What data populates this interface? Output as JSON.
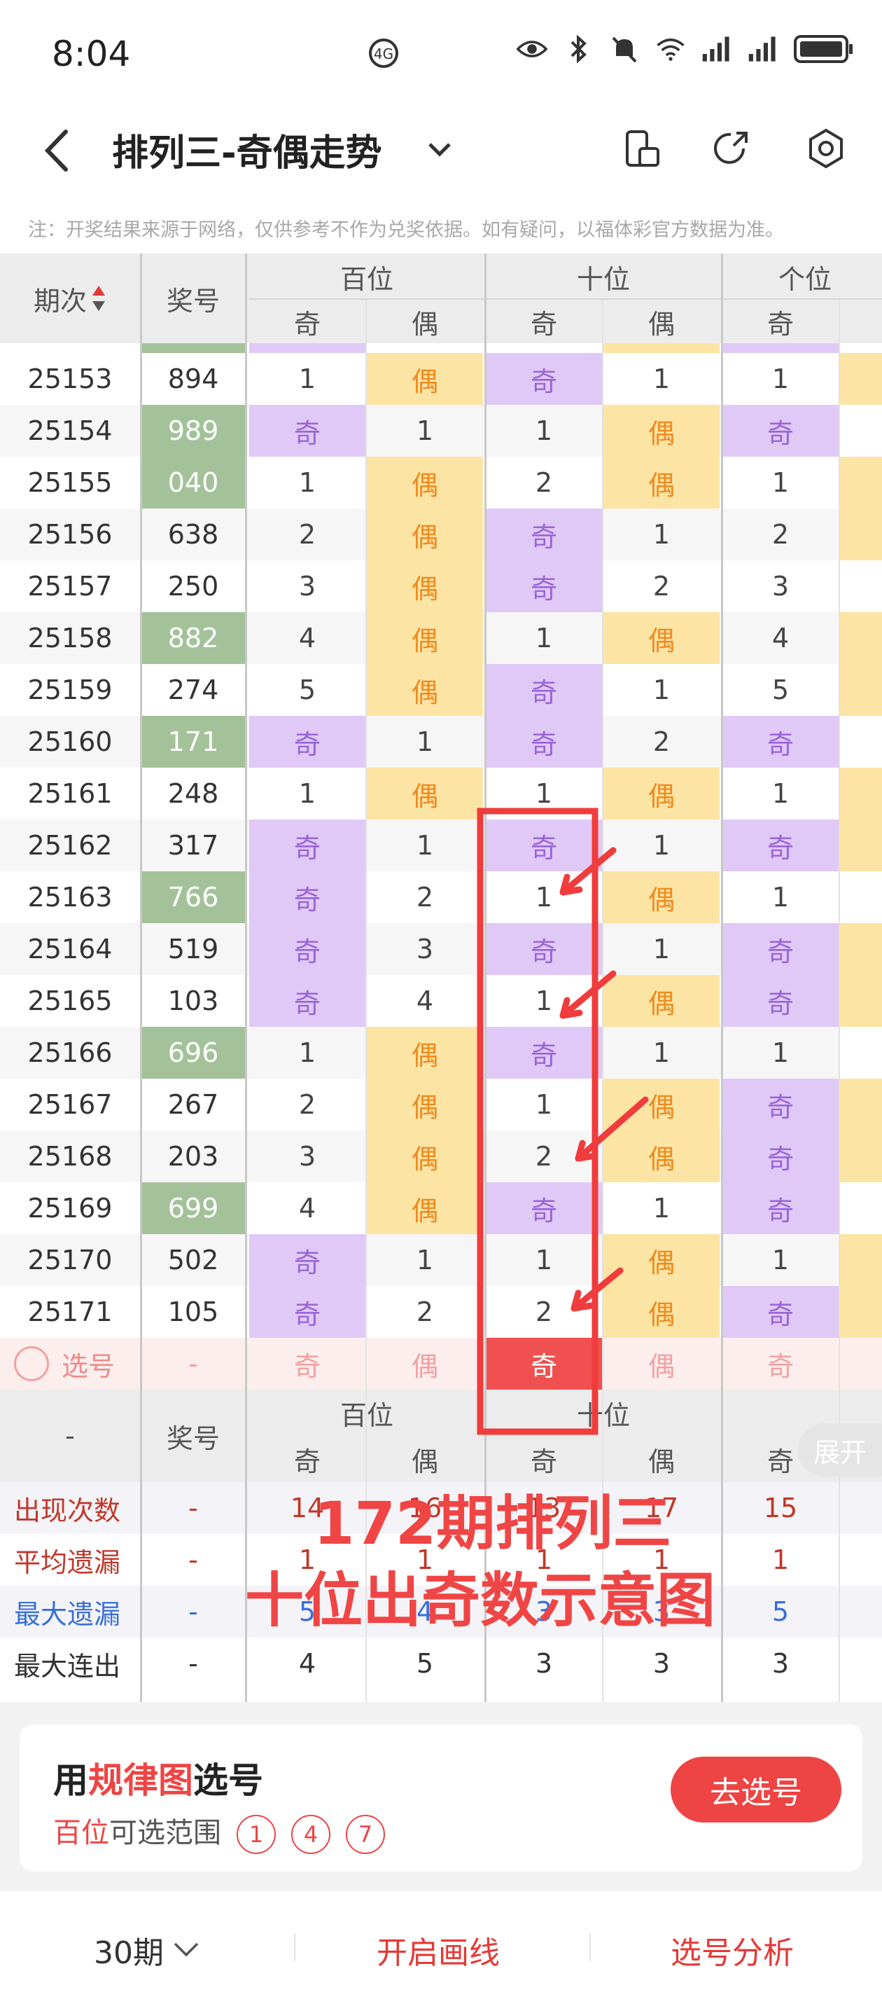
{
  "status": {
    "time": "8:04"
  },
  "header": {
    "title": "排列三-奇偶走势"
  },
  "note": "注：开奖结果来源于网络，仅供参考不作为兑奖依据。如有疑问，以福体彩官方数据为准。",
  "table": {
    "col_issue": "期次",
    "col_number": "奖号",
    "groups": [
      "百位",
      "十位",
      "个位"
    ],
    "odd": "奇",
    "even": "偶",
    "rows": [
      {
        "issue": "25153",
        "number": "894",
        "green": false,
        "cells": [
          "1",
          "偶",
          "奇",
          "1",
          "1"
        ]
      },
      {
        "issue": "25154",
        "number": "989",
        "green": true,
        "cells": [
          "奇",
          "1",
          "1",
          "偶",
          "奇"
        ]
      },
      {
        "issue": "25155",
        "number": "040",
        "green": true,
        "cells": [
          "1",
          "偶",
          "2",
          "偶",
          "1"
        ]
      },
      {
        "issue": "25156",
        "number": "638",
        "green": false,
        "cells": [
          "2",
          "偶",
          "奇",
          "1",
          "2"
        ]
      },
      {
        "issue": "25157",
        "number": "250",
        "green": false,
        "cells": [
          "3",
          "偶",
          "奇",
          "2",
          "3"
        ]
      },
      {
        "issue": "25158",
        "number": "882",
        "green": true,
        "cells": [
          "4",
          "偶",
          "1",
          "偶",
          "4"
        ]
      },
      {
        "issue": "25159",
        "number": "274",
        "green": false,
        "cells": [
          "5",
          "偶",
          "奇",
          "1",
          "5"
        ]
      },
      {
        "issue": "25160",
        "number": "171",
        "green": true,
        "cells": [
          "奇",
          "1",
          "奇",
          "2",
          "奇"
        ]
      },
      {
        "issue": "25161",
        "number": "248",
        "green": false,
        "cells": [
          "1",
          "偶",
          "1",
          "偶",
          "1"
        ]
      },
      {
        "issue": "25162",
        "number": "317",
        "green": false,
        "cells": [
          "奇",
          "1",
          "奇",
          "1",
          "奇"
        ]
      },
      {
        "issue": "25163",
        "number": "766",
        "green": true,
        "cells": [
          "奇",
          "2",
          "1",
          "偶",
          "1"
        ]
      },
      {
        "issue": "25164",
        "number": "519",
        "green": false,
        "cells": [
          "奇",
          "3",
          "奇",
          "1",
          "奇"
        ]
      },
      {
        "issue": "25165",
        "number": "103",
        "green": false,
        "cells": [
          "奇",
          "4",
          "1",
          "偶",
          "奇"
        ]
      },
      {
        "issue": "25166",
        "number": "696",
        "green": true,
        "cells": [
          "1",
          "偶",
          "奇",
          "1",
          "1"
        ]
      },
      {
        "issue": "25167",
        "number": "267",
        "green": false,
        "cells": [
          "2",
          "偶",
          "1",
          "偶",
          "奇"
        ]
      },
      {
        "issue": "25168",
        "number": "203",
        "green": false,
        "cells": [
          "3",
          "偶",
          "2",
          "偶",
          "奇"
        ]
      },
      {
        "issue": "25169",
        "number": "699",
        "green": true,
        "cells": [
          "4",
          "偶",
          "奇",
          "1",
          "奇"
        ]
      },
      {
        "issue": "25170",
        "number": "502",
        "green": false,
        "cells": [
          "奇",
          "1",
          "1",
          "偶",
          "1"
        ]
      },
      {
        "issue": "25171",
        "number": "105",
        "green": false,
        "cells": [
          "奇",
          "2",
          "2",
          "偶",
          "奇"
        ]
      }
    ],
    "select_row": {
      "label": "选号",
      "number": "-",
      "cells": [
        "奇",
        "偶",
        "奇",
        "偶",
        "奇"
      ]
    },
    "footer_dash": "-",
    "stats": [
      {
        "label": "出现次数",
        "dash": "-",
        "values": [
          "14",
          "16",
          "13",
          "17",
          "15"
        ],
        "color": "#c0392b"
      },
      {
        "label": "平均遗漏",
        "dash": "-",
        "values": [
          "1",
          "1",
          "1",
          "1",
          "1"
        ],
        "color": "#c0392b"
      },
      {
        "label": "最大遗漏",
        "dash": "-",
        "values": [
          "5",
          "4",
          "3",
          "3",
          "5"
        ],
        "color": "#3a6fd8"
      },
      {
        "label": "最大连出",
        "dash": "-",
        "values": [
          "4",
          "5",
          "3",
          "3",
          "3"
        ],
        "color": "#333333"
      }
    ]
  },
  "expand_label": "展开",
  "overlay": {
    "line1": "172期排列三",
    "line2": "十位出奇数示意图"
  },
  "pick": {
    "title_pre": "用",
    "title_red": "规律图",
    "title_post": "选号",
    "sub_red": "百位",
    "sub_post": "可选范围",
    "balls": [
      "1",
      "4",
      "7"
    ],
    "button": "去选号"
  },
  "bottom": {
    "periods": "30期",
    "draw": "开启画线",
    "analysis": "选号分析"
  }
}
